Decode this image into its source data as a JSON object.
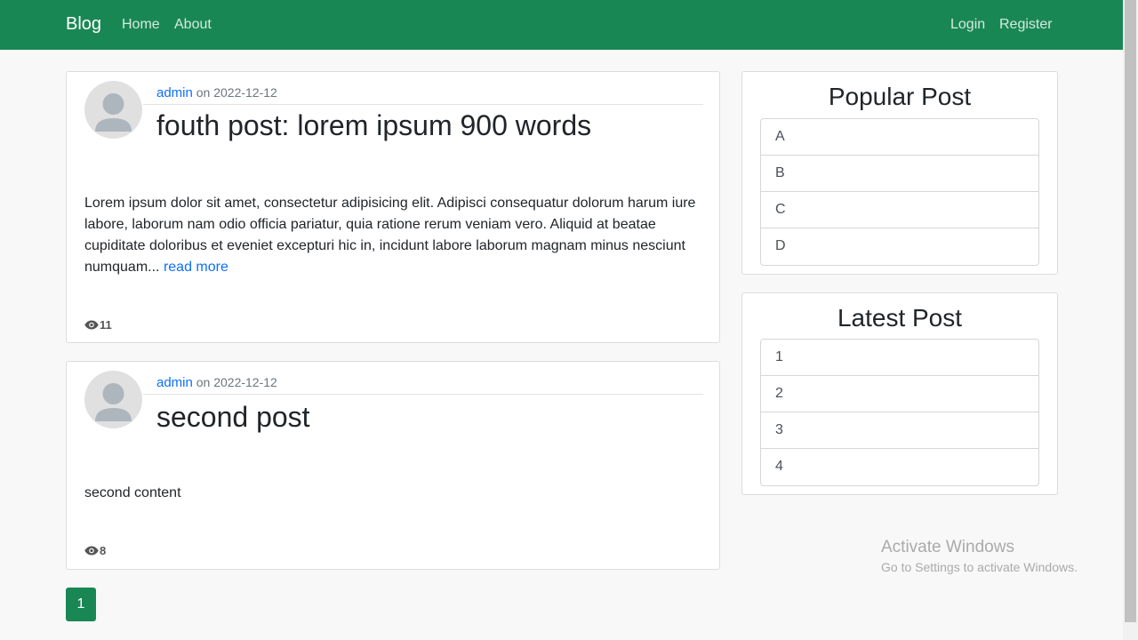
{
  "navbar": {
    "brand": "Blog",
    "links": [
      "Home",
      "About"
    ],
    "auth": [
      "Login",
      "Register"
    ]
  },
  "posts": [
    {
      "author": "admin",
      "on": "on",
      "date": "2022-12-12",
      "title": "fouth post: lorem ipsum 900 words",
      "excerpt": "Lorem ipsum dolor sit amet, consectetur adipisicing elit. Adipisci consequatur dolorum harum iure labore, laborum nam odio officia pariatur, quia ratione rerum veniam vero. Aliquid at beatae cupiditate doloribus et eveniet excepturi hic in, incidunt labore laborum magnam minus nesciunt numquam...",
      "read_more": "read more",
      "views": "11"
    },
    {
      "author": "admin",
      "on": "on",
      "date": "2022-12-12",
      "title": "second post",
      "excerpt": "second content",
      "views": "8"
    }
  ],
  "pagination": {
    "current": "1"
  },
  "sidebar": {
    "popular": {
      "title": "Popular Post",
      "items": [
        "A",
        "B",
        "C",
        "D"
      ]
    },
    "latest": {
      "title": "Latest Post",
      "items": [
        "1",
        "2",
        "3",
        "4"
      ]
    }
  },
  "watermark": {
    "line1": "Activate Windows",
    "line2": "Go to Settings to activate Windows."
  },
  "colors": {
    "navbar": "#198754",
    "link": "#0d6efd",
    "page_bg": "#f8f8f8"
  }
}
